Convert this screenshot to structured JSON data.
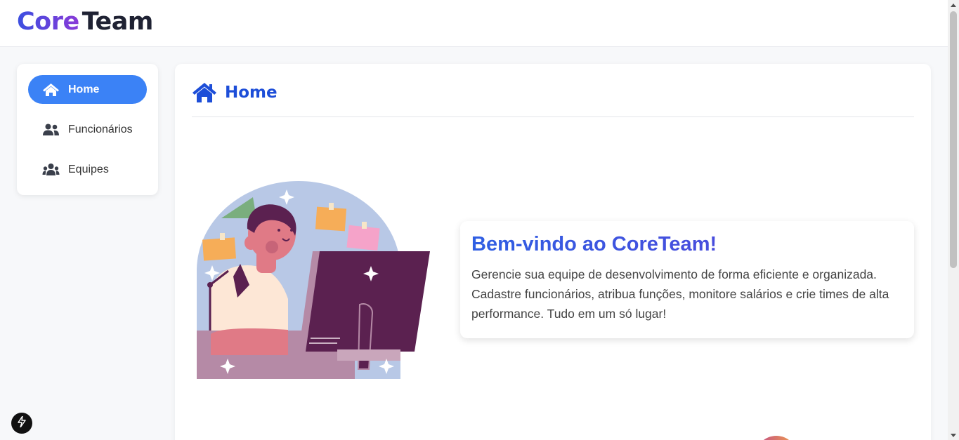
{
  "brand": {
    "part1": "Core",
    "part2": "Team"
  },
  "sidebar": {
    "items": [
      {
        "label": "Home",
        "icon": "home-icon",
        "active": true
      },
      {
        "label": "Funcionários",
        "icon": "users-icon",
        "active": false
      },
      {
        "label": "Equipes",
        "icon": "team-icon",
        "active": false
      }
    ]
  },
  "main": {
    "title": "Home",
    "title_icon": "home-icon",
    "welcome": {
      "heading": "Bem-vindo ao CoreTeam!",
      "body": "Gerencie sua equipe de desenvolvimento de forma eficiente e organizada. Cadastre funcionários, atribua funções, monitore salários e crie times de alta performance. Tudo em um só lugar!"
    }
  },
  "colors": {
    "accent": "#3b82f6",
    "title": "#1d4ed8",
    "brand_gradient_start": "#3b4fe0",
    "brand_gradient_end": "#8a3ad8"
  }
}
